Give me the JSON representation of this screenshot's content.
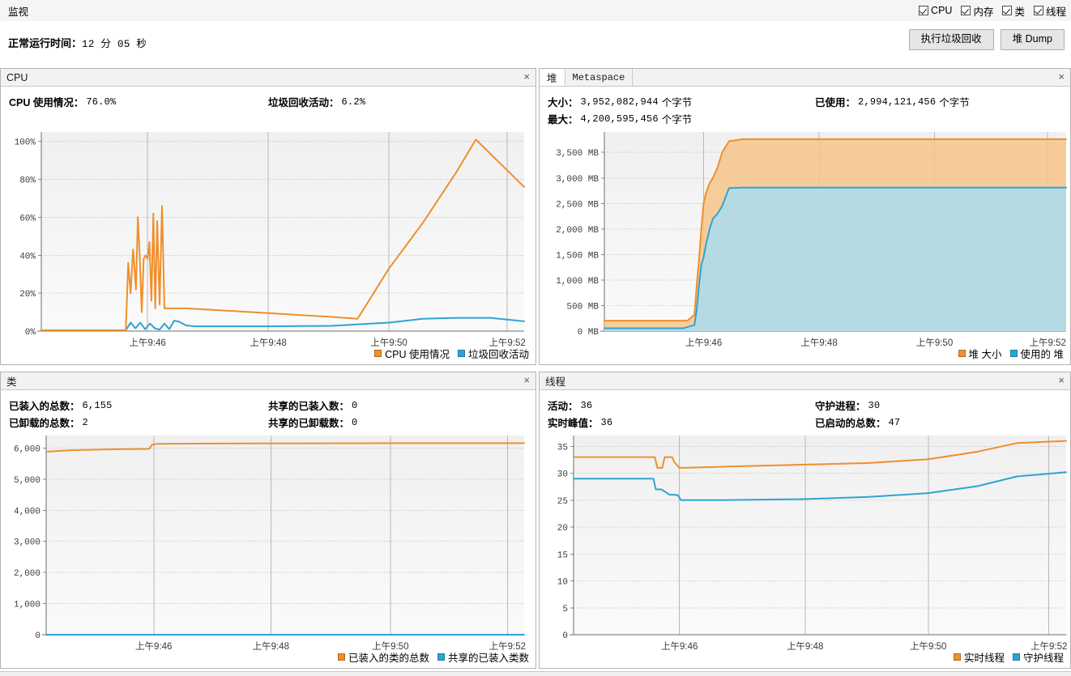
{
  "topbar": {
    "title": "监视",
    "toggles": [
      {
        "label": "CPU",
        "checked": true,
        "name": "cpu"
      },
      {
        "label": "内存",
        "checked": true,
        "name": "memory"
      },
      {
        "label": "类",
        "checked": true,
        "name": "classes"
      },
      {
        "label": "线程",
        "checked": true,
        "name": "threads"
      }
    ]
  },
  "uptime": {
    "label": "正常运行时间：",
    "value": "12 分 05 秒"
  },
  "actions": {
    "gc_label": "执行垃圾回收",
    "heapdump_label": "堆 Dump"
  },
  "panels": {
    "cpu": {
      "title": "CPU",
      "close": "×",
      "stats": [
        {
          "label": "CPU 使用情况：",
          "value": "76.0%"
        },
        {
          "label": "垃圾回收活动：",
          "value": "6.2%"
        }
      ]
    },
    "heap": {
      "tabs": [
        {
          "label": "堆",
          "active": true
        },
        {
          "label": "Metaspace",
          "active": false
        }
      ],
      "close": "×",
      "stats": [
        {
          "label": "大小：",
          "value": "3,952,082,944",
          "unit": "个字节"
        },
        {
          "label": "已使用：",
          "value": "2,994,121,456",
          "unit": "个字节"
        },
        {
          "label": "最大：",
          "value": "4,200,595,456",
          "unit": "个字节"
        }
      ]
    },
    "classes": {
      "title": "类",
      "close": "×",
      "stats": [
        {
          "label": "已装入的总数：",
          "value": "6,155"
        },
        {
          "label": "共享的已装入数：",
          "value": "0"
        },
        {
          "label": "已卸载的总数：",
          "value": "2"
        },
        {
          "label": "共享的已卸载数：",
          "value": "0"
        }
      ]
    },
    "threads": {
      "title": "线程",
      "close": "×",
      "stats": [
        {
          "label": "活动：",
          "value": "36"
        },
        {
          "label": "守护进程：",
          "value": "30"
        },
        {
          "label": "实时峰值：",
          "value": "36"
        },
        {
          "label": "已启动的总数：",
          "value": "47"
        }
      ]
    }
  },
  "colors": {
    "orange": "#ef8f2c",
    "blue": "#2fa3d4",
    "orange_fill": "#f6c68a",
    "blue_fill": "#aadcf0",
    "plot_bg_top": "#f0f0f0",
    "plot_bg_bottom": "#fafafa",
    "grid": "#c0c0c0"
  },
  "chart_data": [
    {
      "id": "cpu",
      "type": "line",
      "title": "CPU",
      "xlabel": "",
      "ylabel": "",
      "ylim": [
        0,
        105
      ],
      "yticks": [
        0,
        20,
        40,
        60,
        80,
        100
      ],
      "ytick_labels": [
        "0%",
        "20%",
        "40%",
        "60%",
        "80%",
        "100%"
      ],
      "xticks": [
        "上午9:46",
        "上午9:48",
        "上午9:50",
        "上午9:52"
      ],
      "xtick_positions": [
        0.22,
        0.47,
        0.72,
        0.965
      ],
      "grid": true,
      "legend_position": "bottom-right",
      "series": [
        {
          "name": "CPU 使用情况",
          "color": "#ef8f2c",
          "x": [
            0.0,
            0.14,
            0.175,
            0.18,
            0.185,
            0.19,
            0.193,
            0.196,
            0.2,
            0.204,
            0.208,
            0.212,
            0.216,
            0.22,
            0.224,
            0.228,
            0.232,
            0.236,
            0.24,
            0.245,
            0.25,
            0.255,
            0.26,
            0.265,
            0.27,
            0.275,
            0.28,
            0.285,
            0.29,
            0.3,
            0.47,
            0.6,
            0.655,
            0.72,
            0.79,
            0.86,
            0.9,
            1.0
          ],
          "y": [
            0.5,
            0.5,
            0.5,
            36,
            20,
            43,
            33,
            22,
            60,
            38,
            10,
            38,
            40,
            38,
            47,
            16,
            62,
            12,
            58,
            14,
            66,
            12,
            12,
            12,
            12,
            12,
            12,
            12,
            12,
            12,
            9.5,
            7.5,
            6.5,
            33,
            57,
            84,
            101,
            76
          ]
        },
        {
          "name": "垃圾回收活动",
          "color": "#2fa3d4",
          "x": [
            0.0,
            0.14,
            0.175,
            0.185,
            0.195,
            0.205,
            0.215,
            0.225,
            0.235,
            0.245,
            0.255,
            0.265,
            0.275,
            0.285,
            0.3,
            0.32,
            0.47,
            0.6,
            0.72,
            0.79,
            0.86,
            0.93,
            1.0
          ],
          "y": [
            0.3,
            0.3,
            0.5,
            4.5,
            1.5,
            4.5,
            1.0,
            4.0,
            1.5,
            0.8,
            4.0,
            1.0,
            5.5,
            5.0,
            3.0,
            2.5,
            2.5,
            2.8,
            4.5,
            6.5,
            7.0,
            7.0,
            5.2
          ]
        }
      ]
    },
    {
      "id": "heap",
      "type": "area",
      "title": "堆",
      "unit": "MB",
      "ylim": [
        0,
        3900
      ],
      "yticks": [
        0,
        500,
        1000,
        1500,
        2000,
        2500,
        3000,
        3500
      ],
      "ytick_labels": [
        "0 MB",
        "500 MB",
        "1,000 MB",
        "1,500 MB",
        "2,000 MB",
        "2,500 MB",
        "3,000 MB",
        "3,500 MB"
      ],
      "xticks": [
        "上午9:46",
        "上午9:48",
        "上午9:50",
        "上午9:52"
      ],
      "xtick_positions": [
        0.215,
        0.465,
        0.715,
        0.96
      ],
      "grid": true,
      "legend_position": "bottom-right",
      "series": [
        {
          "name": "堆 大小",
          "color": "#ef8f2c",
          "fill": "#f6c68a",
          "x": [
            0.0,
            0.18,
            0.195,
            0.2,
            0.205,
            0.21,
            0.215,
            0.22,
            0.228,
            0.235,
            0.245,
            0.255,
            0.27,
            0.3,
            0.5,
            0.75,
            1.0
          ],
          "y": [
            205,
            205,
            320,
            900,
            1400,
            2000,
            2500,
            2700,
            2900,
            3000,
            3200,
            3500,
            3720,
            3760,
            3760,
            3760,
            3760
          ]
        },
        {
          "name": "使用的 堆",
          "color": "#2fa3d4",
          "fill": "#aadcf0",
          "x": [
            0.0,
            0.17,
            0.195,
            0.2,
            0.205,
            0.21,
            0.215,
            0.22,
            0.228,
            0.235,
            0.245,
            0.255,
            0.27,
            0.3,
            0.5,
            0.75,
            1.0
          ],
          "y": [
            55,
            55,
            120,
            420,
            900,
            1300,
            1450,
            1700,
            2000,
            2200,
            2300,
            2450,
            2800,
            2810,
            2810,
            2810,
            2810
          ]
        }
      ]
    },
    {
      "id": "classes",
      "type": "line",
      "title": "类",
      "ylim": [
        0,
        6400
      ],
      "yticks": [
        0,
        1000,
        2000,
        3000,
        4000,
        5000,
        6000
      ],
      "ytick_labels": [
        "0",
        "1,000",
        "2,000",
        "3,000",
        "4,000",
        "5,000",
        "6,000"
      ],
      "xticks": [
        "上午9:46",
        "上午9:48",
        "上午9:50",
        "上午9:52"
      ],
      "xtick_positions": [
        0.225,
        0.47,
        0.72,
        0.965
      ],
      "grid": true,
      "legend_position": "bottom-right",
      "series": [
        {
          "name": "已装入的类的总数",
          "color": "#ef8f2c",
          "x": [
            0.0,
            0.05,
            0.15,
            0.215,
            0.222,
            0.235,
            0.3,
            0.5,
            0.75,
            1.0
          ],
          "y": [
            5880,
            5930,
            5960,
            5970,
            6110,
            6135,
            6140,
            6150,
            6155,
            6155
          ]
        },
        {
          "name": "共享的已装入类数",
          "color": "#2fa3d4",
          "x": [
            0.0,
            1.0
          ],
          "y": [
            0,
            0
          ]
        }
      ]
    },
    {
      "id": "threads",
      "type": "line",
      "title": "线程",
      "ylim": [
        0,
        37
      ],
      "yticks": [
        0,
        5,
        10,
        15,
        20,
        25,
        30,
        35
      ],
      "ytick_labels": [
        "0",
        "5",
        "10",
        "15",
        "20",
        "25",
        "30",
        "35"
      ],
      "xticks": [
        "上午9:46",
        "上午9:48",
        "上午9:50",
        "上午9:52"
      ],
      "xtick_positions": [
        0.215,
        0.47,
        0.72,
        0.965
      ],
      "grid": true,
      "legend_position": "bottom-right",
      "series": [
        {
          "name": "实时线程",
          "color": "#ef8f2c",
          "x": [
            0.0,
            0.165,
            0.17,
            0.18,
            0.185,
            0.2,
            0.205,
            0.215,
            0.22,
            0.3,
            0.47,
            0.6,
            0.72,
            0.82,
            0.9,
            1.0
          ],
          "y": [
            33,
            33,
            31,
            31,
            33,
            33,
            32,
            31,
            31,
            31.2,
            31.6,
            31.9,
            32.6,
            34,
            35.6,
            36
          ]
        },
        {
          "name": "守护线程",
          "color": "#2fa3d4",
          "x": [
            0.0,
            0.162,
            0.167,
            0.178,
            0.185,
            0.195,
            0.205,
            0.212,
            0.218,
            0.3,
            0.47,
            0.6,
            0.72,
            0.82,
            0.9,
            1.0
          ],
          "y": [
            29,
            29,
            27,
            27,
            26.6,
            26,
            26,
            25.9,
            25,
            25,
            25.2,
            25.6,
            26.3,
            27.6,
            29.4,
            30.2
          ]
        }
      ]
    }
  ]
}
